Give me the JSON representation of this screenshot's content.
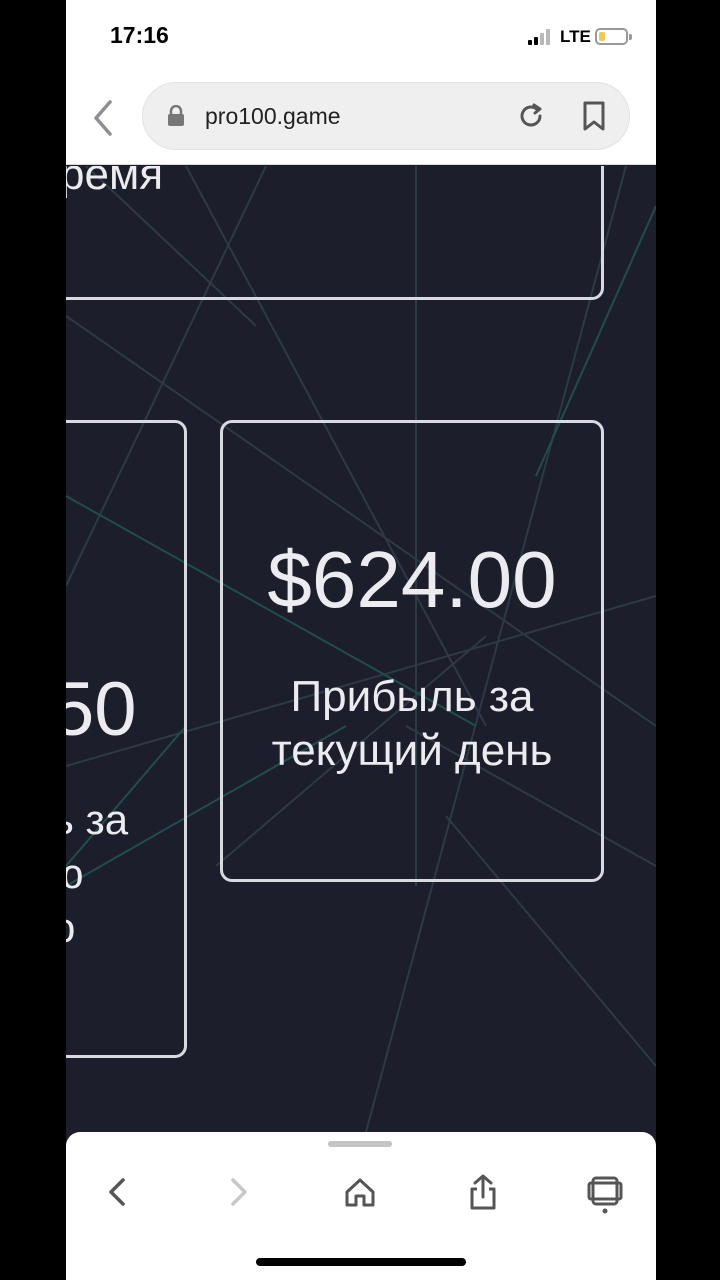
{
  "status": {
    "time": "17:16",
    "network": "LTE"
  },
  "browser": {
    "url": "pro100.game"
  },
  "cards": {
    "top_fragment": "ремя",
    "left_value_fragment": "50",
    "left_label_fragments": [
      "ь за",
      "ю",
      "о"
    ],
    "right_value": "$624.00",
    "right_label": "Прибыль за текущий день"
  },
  "icons": {
    "back": "chevron-left-icon",
    "lock": "lock-icon",
    "reload": "reload-icon",
    "bookmark": "bookmark-icon",
    "forward": "chevron-right-icon",
    "home": "home-icon",
    "share": "share-icon",
    "tabs": "tabs-icon"
  },
  "colors": {
    "background": "#1d1e2c",
    "card_border": "#d9d9e0",
    "text": "#ececf0"
  }
}
